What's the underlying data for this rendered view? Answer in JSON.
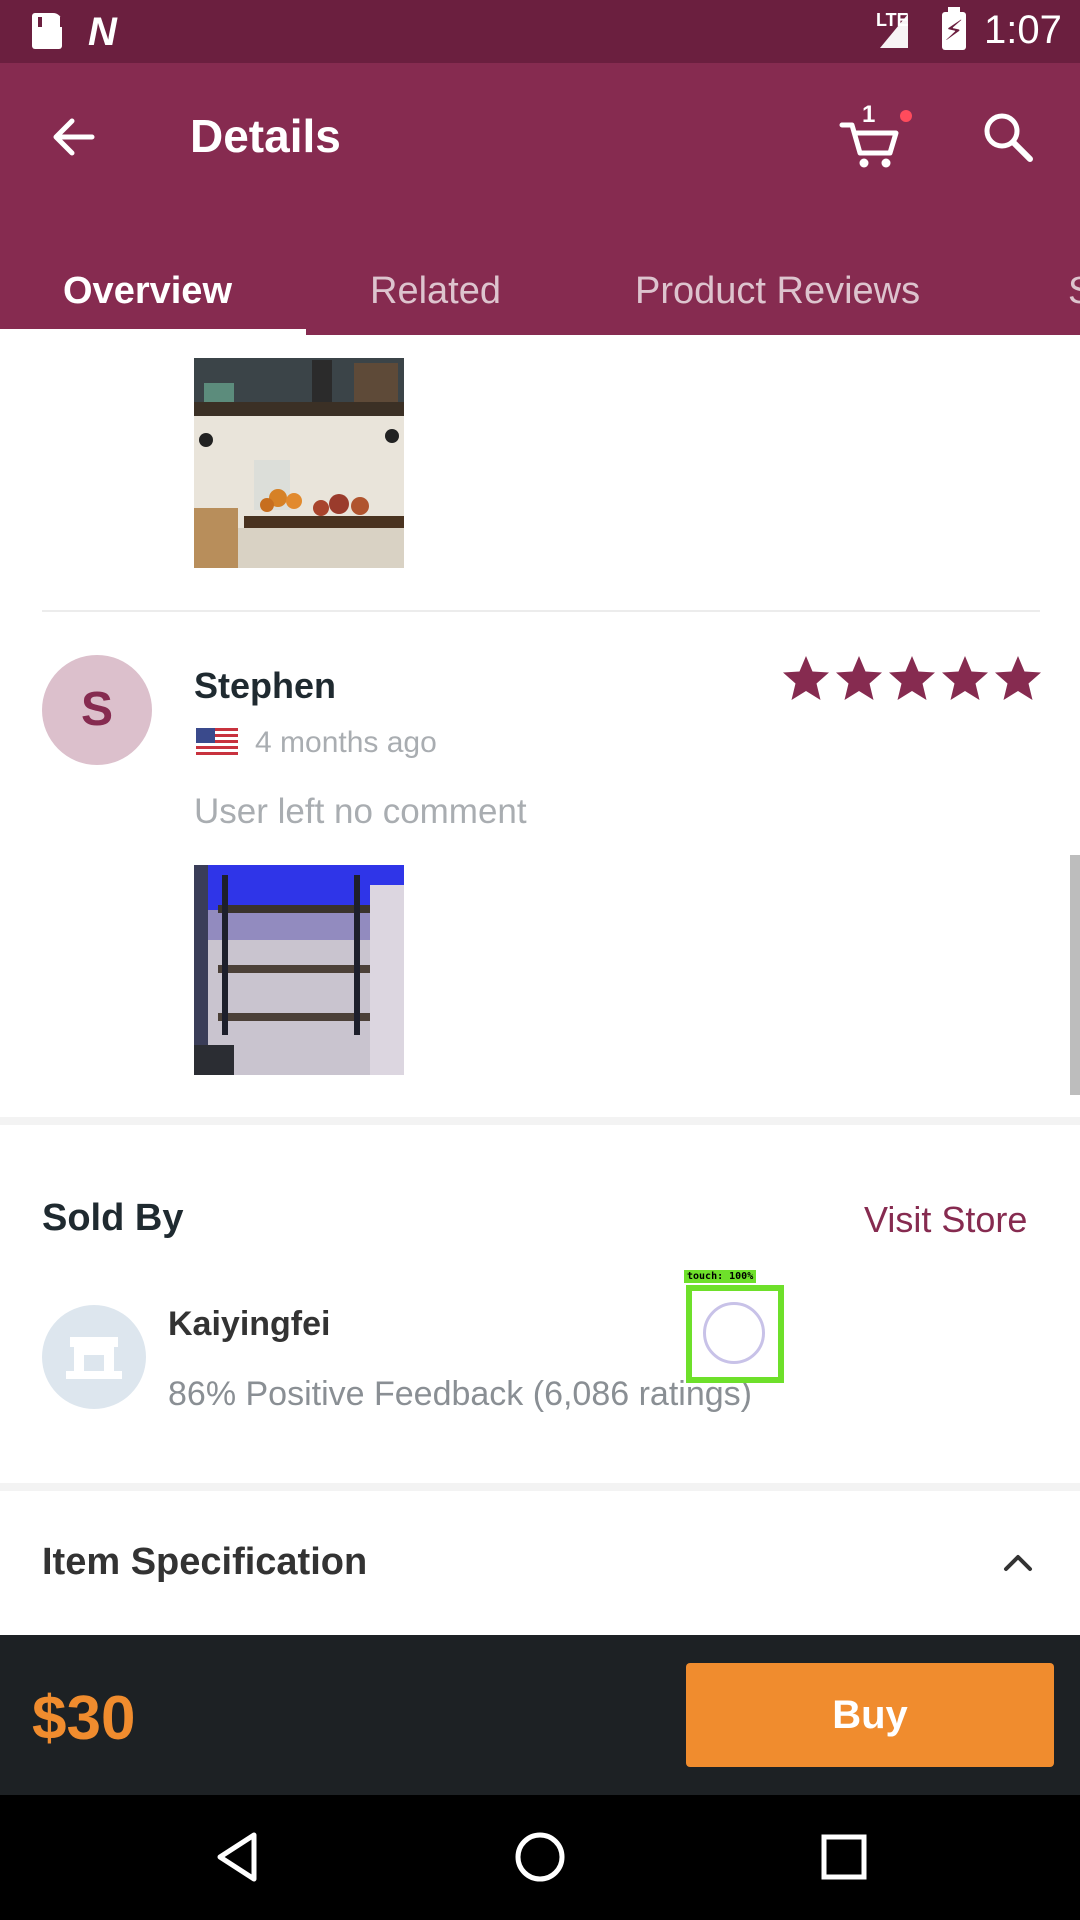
{
  "status_bar": {
    "network": "LTE",
    "time": "1:07"
  },
  "header": {
    "title": "Details",
    "cart_count": "1"
  },
  "tabs": [
    {
      "label": "Overview",
      "active": true
    },
    {
      "label": "Related",
      "active": false
    },
    {
      "label": "Product Reviews",
      "active": false
    },
    {
      "label": "S",
      "active": false
    }
  ],
  "reviews": [
    {
      "avatar_letter": "S",
      "name": "Stephen",
      "rating": 5,
      "country_flag": "us-flag-icon",
      "time": "4 months ago",
      "comment": "User left no comment"
    }
  ],
  "seller": {
    "section_title": "Sold By",
    "visit_store_label": "Visit Store",
    "name": "Kaiyingfei",
    "feedback": "86% Positive Feedback (6,086 ratings)"
  },
  "overlay": {
    "touch_label": "touch: 100%"
  },
  "spec": {
    "title": "Item Specification",
    "expanded": true
  },
  "purchase": {
    "price": "$30",
    "buy_label": "Buy"
  },
  "colors": {
    "brand": "#862b50",
    "status_bar": "#6b1f3f",
    "accent": "#f08c2e",
    "bottom_bar": "#1d2124"
  }
}
